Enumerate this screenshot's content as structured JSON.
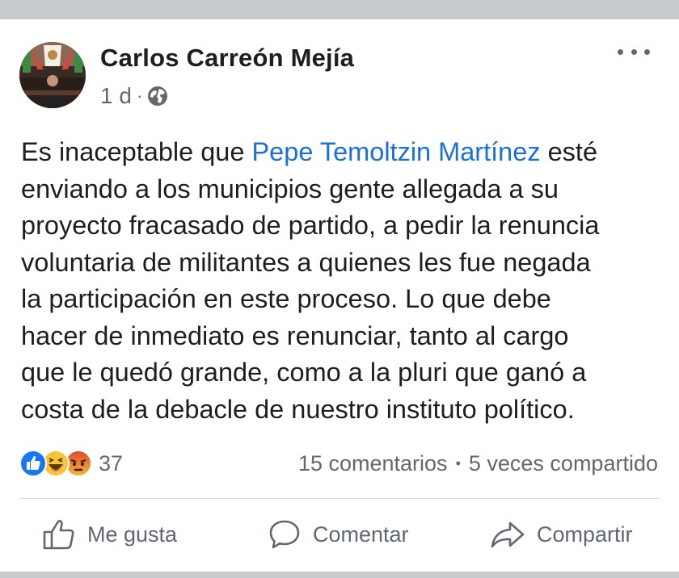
{
  "post": {
    "author": "Carlos Carreón Mejía",
    "time": "1 d",
    "separator": "·",
    "privacy_icon": "globe-icon",
    "more_icon": "more-options-icon",
    "text_lines": [
      {
        "before": "Es inaceptable que ",
        "link": "Pepe Temoltzin Martínez",
        "after": " esté"
      },
      {
        "before": "enviando a los municipios gente allegada a su"
      },
      {
        "before": "proyecto fracasado de partido, a pedir la renuncia"
      },
      {
        "before": "voluntaria de militantes a quienes les fue negada"
      },
      {
        "before": "la participación en este proceso. Lo que debe"
      },
      {
        "before": "hacer de inmediato es renunciar, tanto al cargo"
      },
      {
        "before": "que le quedó grande, como a la pluri que ganó a"
      },
      {
        "before": "costa de la debacle de nuestro instituto político."
      }
    ]
  },
  "engagement": {
    "reaction_icons": [
      "like-icon",
      "haha-icon",
      "angry-icon"
    ],
    "reaction_count": "37",
    "comments": "15 comentarios",
    "stats_separator": "•",
    "shares": "5 veces compartido"
  },
  "actions": {
    "like_label": "Me gusta",
    "comment_label": "Comentar",
    "share_label": "Compartir"
  },
  "colors": {
    "link": "#1a6fde",
    "like_blue": "#1877f2",
    "haha_yellow": "#f7c536",
    "angry_orange": "#e9710f",
    "background": "#c9cccf"
  }
}
